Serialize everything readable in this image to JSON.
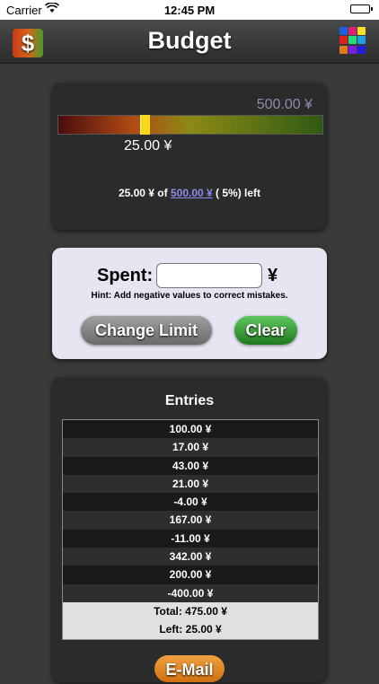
{
  "status_bar": {
    "carrier": "Carrier",
    "time": "12:45 PM"
  },
  "nav": {
    "title": "Budget",
    "app_icon_glyph": "$",
    "app_icon": "dollar-app-icon",
    "menu_icon": "color-grid-icon",
    "grid_colors": [
      "#1f5fe0",
      "#e01f7a",
      "#f7e21f",
      "#e01f1f",
      "#1fe07a",
      "#1fa0e0",
      "#e07a1f",
      "#7a1fe0",
      "#1f1fe0"
    ]
  },
  "budget": {
    "limit_label": "500.00 ¥",
    "spent_label": "25.00 ¥",
    "summary_prefix": "25.00 ¥ of",
    "summary_limit_link": "500.00 ¥",
    "summary_suffix": "( 5%) left",
    "spent_fraction": 0.05
  },
  "spent_form": {
    "label": "Spent:",
    "input_value": "",
    "currency": "¥",
    "hint": "Hint: Add negative values to correct mistakes.",
    "change_limit_button": "Change Limit",
    "clear_button": "Clear"
  },
  "entries": {
    "title": "Entries",
    "rows": [
      "100.00 ¥",
      "17.00 ¥",
      "43.00 ¥",
      "21.00 ¥",
      "-4.00 ¥",
      "167.00 ¥",
      "-11.00 ¥",
      "342.00 ¥",
      "200.00 ¥",
      "-400.00 ¥"
    ],
    "total": "Total: 475.00 ¥",
    "left": "Left: 25.00 ¥",
    "email_button": "E-Mail"
  }
}
